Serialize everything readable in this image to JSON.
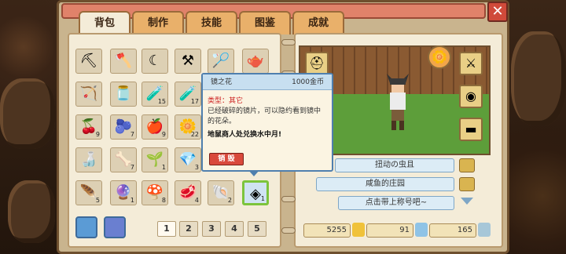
{
  "close_label": "✕",
  "tabs": [
    {
      "label": "背包",
      "active": true
    },
    {
      "label": "制作"
    },
    {
      "label": "技能"
    },
    {
      "label": "图鉴"
    },
    {
      "label": "成就"
    }
  ],
  "inventory": [
    {
      "icon": "pickaxe-icon",
      "glyph": "⛏",
      "count": ""
    },
    {
      "icon": "axe-icon",
      "glyph": "🪓",
      "count": ""
    },
    {
      "icon": "sickle-icon",
      "glyph": "☾",
      "count": ""
    },
    {
      "icon": "hoe-icon",
      "glyph": "⚒",
      "count": ""
    },
    {
      "icon": "net-icon",
      "glyph": "🏸",
      "count": ""
    },
    {
      "icon": "watering-can-icon",
      "glyph": "🫖",
      "count": ""
    },
    {
      "icon": "bow-icon",
      "glyph": "🏹",
      "count": ""
    },
    {
      "icon": "jar-icon",
      "glyph": "🫙",
      "count": ""
    },
    {
      "icon": "red-potion-icon",
      "glyph": "🧪",
      "count": "15"
    },
    {
      "icon": "orange-potion-icon",
      "glyph": "🧪",
      "count": "17"
    },
    {
      "icon": "cherry-icon",
      "glyph": "🍒",
      "count": "9"
    },
    {
      "icon": "blackberry-icon",
      "glyph": "🫐",
      "count": "7"
    },
    {
      "icon": "apple-icon",
      "glyph": "🍎",
      "count": "9"
    },
    {
      "icon": "flower-icon",
      "glyph": "🌼",
      "count": "22"
    },
    {
      "icon": "green-potion-icon",
      "glyph": "🍶",
      "count": ""
    },
    {
      "icon": "bone-icon",
      "glyph": "🦴",
      "count": "7"
    },
    {
      "icon": "seed-icon",
      "glyph": "🌱",
      "count": "1"
    },
    {
      "icon": "crystal-icon",
      "glyph": "💎",
      "count": "3"
    },
    {
      "icon": "feather-icon",
      "glyph": "🪶",
      "count": "5"
    },
    {
      "icon": "orb-icon",
      "glyph": "🔮",
      "count": "1"
    },
    {
      "icon": "mushroom-icon",
      "glyph": "🍄",
      "count": "8"
    },
    {
      "icon": "meat-icon",
      "glyph": "🥩",
      "count": "4"
    },
    {
      "icon": "shell-icon",
      "glyph": "🐚",
      "count": "2"
    },
    {
      "icon": "mirror-shard-icon",
      "glyph": "◈",
      "count": "1"
    }
  ],
  "pages": [
    "1",
    "2",
    "3",
    "4",
    "5"
  ],
  "tooltip": {
    "name": "镜之花",
    "price": "1000金币",
    "type": "类型：其它",
    "desc": "已经破碎的镜片，可以隐约看到镜中的花朵。",
    "note": "地鼠商人处兑换水中月!",
    "sell": "销 毁"
  },
  "titles": [
    "扭动の虫且",
    "咸鱼的庄园"
  ],
  "title_placeholder": "点击带上称号吧~",
  "resources": {
    "gold": "5255",
    "gems": "91",
    "orbs": "165"
  },
  "colors": {
    "accent": "#5b9bd5",
    "close": "#d04a3a",
    "sell": "#d9493c"
  }
}
